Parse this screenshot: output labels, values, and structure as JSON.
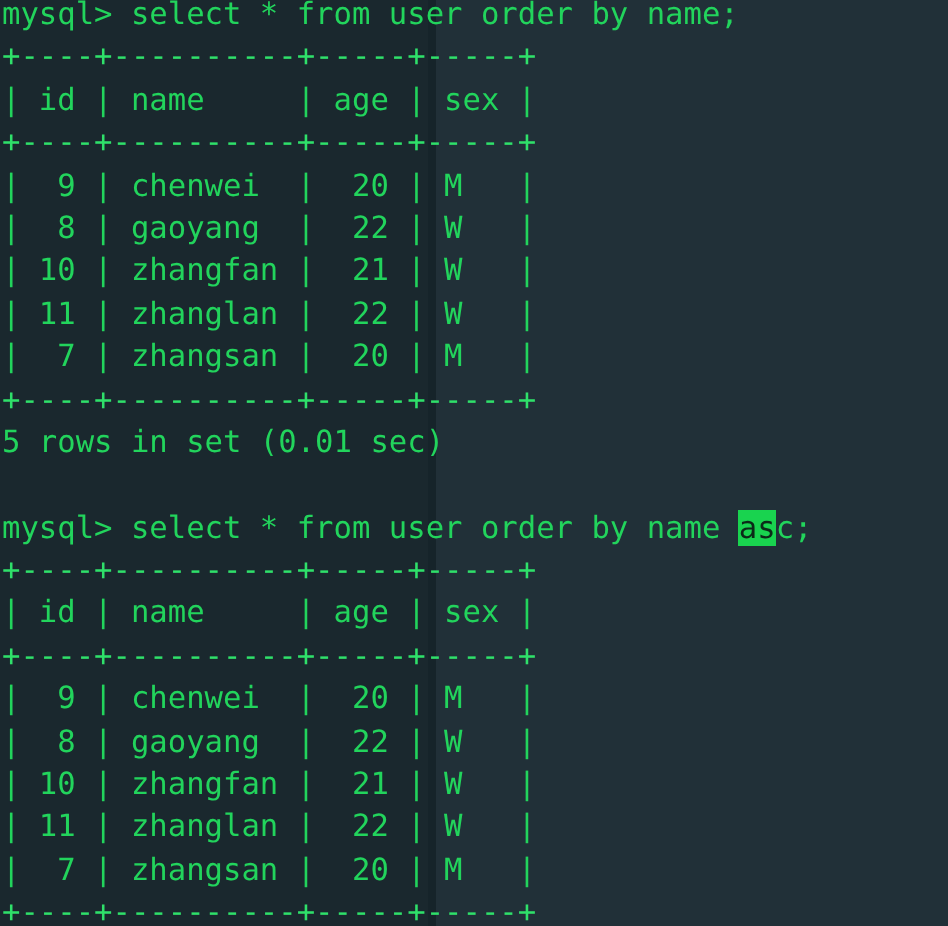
{
  "terminal": {
    "lines": [
      {
        "kind": "prompt",
        "segments": [
          {
            "text": "mysql> select * from user order by name;",
            "highlighted": false
          }
        ]
      },
      {
        "kind": "border",
        "text": "+----+----------+-----+-----+"
      },
      {
        "kind": "row",
        "text": "| id | name     | age | sex |"
      },
      {
        "kind": "border",
        "text": "+----+----------+-----+-----+"
      },
      {
        "kind": "row",
        "text": "|  9 | chenwei  |  20 | M   |"
      },
      {
        "kind": "row",
        "text": "|  8 | gaoyang  |  22 | W   |"
      },
      {
        "kind": "row",
        "text": "| 10 | zhangfan |  21 | W   |"
      },
      {
        "kind": "row",
        "text": "| 11 | zhanglan |  22 | W   |"
      },
      {
        "kind": "row",
        "text": "|  7 | zhangsan |  20 | M   |"
      },
      {
        "kind": "border",
        "text": "+----+----------+-----+-----+"
      },
      {
        "kind": "summary",
        "text": "5 rows in set (0.01 sec)"
      },
      {
        "kind": "prompt",
        "segments": [
          {
            "text": "mysql> select * from user order by name ",
            "highlighted": false
          },
          {
            "text": "as",
            "highlighted": true
          },
          {
            "text": "c;",
            "highlighted": false
          }
        ]
      },
      {
        "kind": "border",
        "text": "+----+----------+-----+-----+"
      },
      {
        "kind": "row",
        "text": "| id | name     | age | sex |"
      },
      {
        "kind": "border",
        "text": "+----+----------+-----+-----+"
      },
      {
        "kind": "row",
        "text": "|  9 | chenwei  |  20 | M   |"
      },
      {
        "kind": "row",
        "text": "|  8 | gaoyang  |  22 | W   |"
      },
      {
        "kind": "row",
        "text": "| 10 | zhangfan |  21 | W   |"
      },
      {
        "kind": "row",
        "text": "| 11 | zhanglan |  22 | W   |"
      },
      {
        "kind": "row",
        "text": "|  7 | zhangsan |  20 | M   |"
      },
      {
        "kind": "border",
        "text": "+----+----------+-----+-----+"
      }
    ]
  }
}
